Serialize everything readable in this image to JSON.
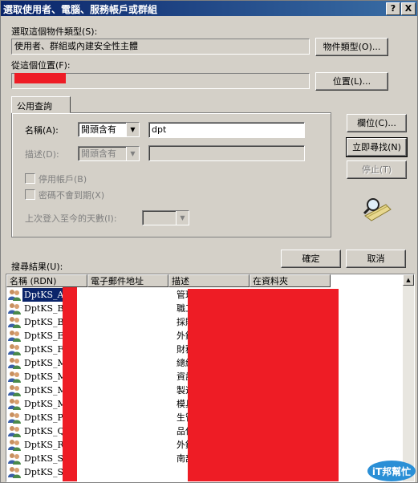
{
  "window": {
    "title": "選取使用者、電腦、服務帳戶或群組",
    "help_btn": "?",
    "close_btn": "X"
  },
  "object_type": {
    "label": "選取這個物件類型(S):",
    "value": "使用者、群組或內建安全性主體",
    "button": "物件類型(O)..."
  },
  "location": {
    "label": "從這個位置(F):",
    "value": "",
    "button": "位置(L)..."
  },
  "query": {
    "tab": "公用查詢",
    "name_label": "名稱(A):",
    "name_mode": "開頭含有",
    "name_value": "dpt",
    "desc_label": "描述(D):",
    "desc_mode": "開頭含有",
    "desc_value": "",
    "disabled_accounts": "停用帳戶(B)",
    "non_expiring": "密碼不會到期(X)",
    "days_label": "上次登入至今的天數(I):",
    "days_value": ""
  },
  "side_buttons": {
    "columns": "欄位(C)...",
    "find_now": "立即尋找(N)",
    "stop": "停止(T)"
  },
  "ok": "確定",
  "cancel": "取消",
  "results": {
    "label": "搜尋結果(U):",
    "columns": [
      "名稱 (RDN)",
      "電子郵件地址",
      "描述",
      "在資料夾"
    ],
    "rows": [
      {
        "name": "DptKS_Ad",
        "desc": "管理"
      },
      {
        "name": "DptKS_BO",
        "desc": "職工"
      },
      {
        "name": "DptKS_BO",
        "desc": "採購"
      },
      {
        "name": "DptKS_ES",
        "desc": "外銷"
      },
      {
        "name": "DptKS_FA",
        "desc": "財務"
      },
      {
        "name": "DptKS_Ma",
        "desc": "總經"
      },
      {
        "name": "DptKS_MI",
        "desc": "資訊"
      },
      {
        "name": "DptKS_MI",
        "desc": "製造"
      },
      {
        "name": "DptKS_Mo",
        "desc": "模具"
      },
      {
        "name": "DptKS_PC",
        "desc": "生管"
      },
      {
        "name": "DptKS_QC",
        "desc": "品保"
      },
      {
        "name": "DptKS_RI",
        "desc": "外銷"
      },
      {
        "name": "DptKS_Sa",
        "desc": "南部"
      },
      {
        "name": "DptKS_SM",
        "desc": ""
      }
    ]
  },
  "colors": {
    "title_bar": "#0a246a",
    "face": "#d4d0c8",
    "selection": "#0a246a",
    "redaction": "#ee1c25"
  },
  "watermark": {
    "text": "iT邦幫忙"
  }
}
